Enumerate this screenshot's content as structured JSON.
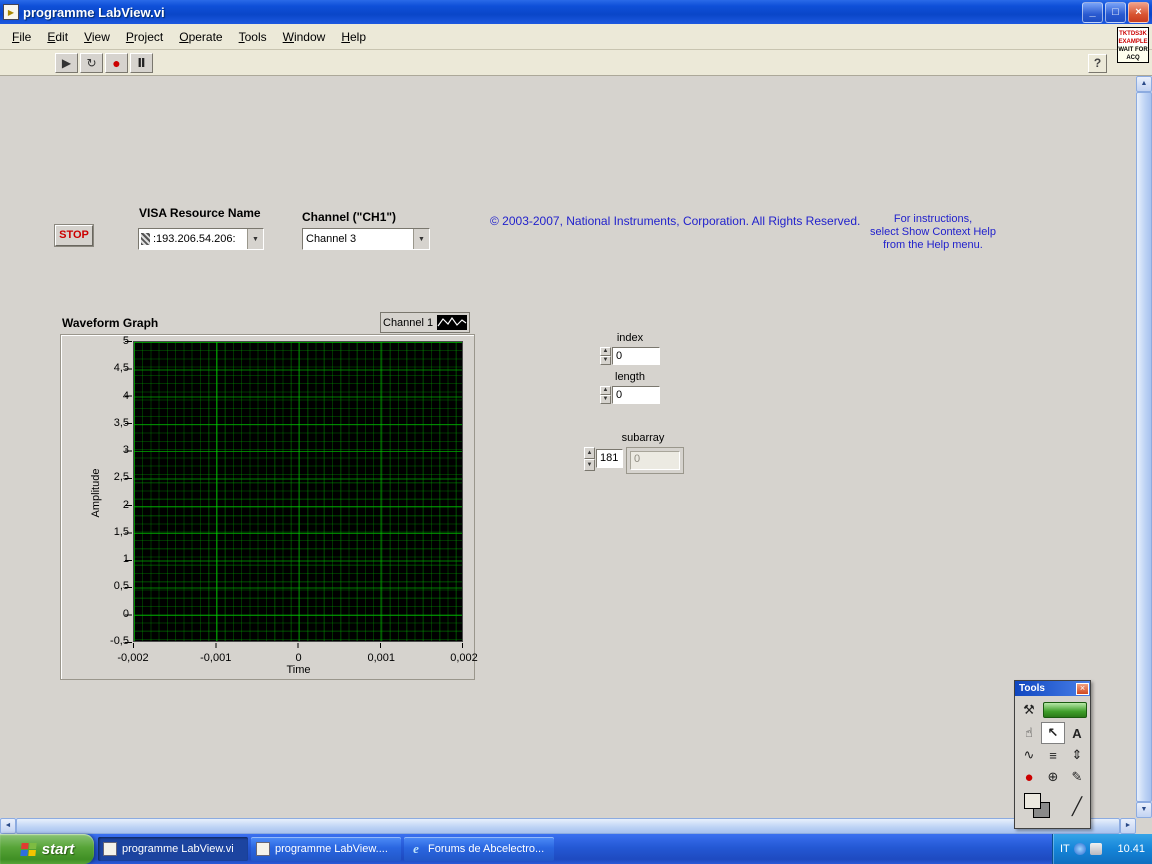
{
  "window": {
    "title": "programme LabView.vi",
    "controls": {
      "minimize": "_",
      "maximize": "□",
      "close": "×"
    }
  },
  "menu_items": [
    "File",
    "Edit",
    "View",
    "Project",
    "Operate",
    "Tools",
    "Window",
    "Help"
  ],
  "vi_icon": {
    "top_lines": [
      "TKTDS3K",
      "EXAMPLE"
    ],
    "bottom_lines": [
      "WAIT FOR",
      "ACQ"
    ]
  },
  "toolbar": {
    "run": "▶",
    "run_continuous": "↻",
    "abort": "●",
    "pause": "Ⅱ",
    "help": "?"
  },
  "icons": {
    "up": "▲",
    "down": "▼",
    "left": "◄",
    "right": "►"
  },
  "panel": {
    "stop_label": "STOP",
    "visa": {
      "label": "VISA Resource Name",
      "value": ":193.206.54.206:"
    },
    "channel": {
      "label": "Channel (\"CH1\")",
      "value": "Channel 3"
    },
    "copyright": "© 2003-2007, National Instruments, Corporation.  All Rights Reserved.",
    "instructions": [
      "For instructions,",
      "select Show Context Help",
      "from the Help menu."
    ],
    "graph": {
      "title": "Waveform Graph",
      "legend": "Channel 1",
      "ylabel": "Amplitude",
      "xlabel": "Time",
      "y_ticks": [
        "5",
        "4,5",
        "4",
        "3,5",
        "3",
        "2,5",
        "2",
        "1,5",
        "1",
        "0,5",
        "0",
        "-0,5"
      ],
      "x_ticks": [
        "-0,002",
        "-0,001",
        "0",
        "0,001",
        "0,002"
      ],
      "y_range": [
        -0.5,
        5
      ],
      "x_range": [
        -0.002,
        0.002
      ],
      "series": []
    },
    "index": {
      "label": "index",
      "value": "0"
    },
    "length": {
      "label": "length",
      "value": "0"
    },
    "subarray": {
      "label": "subarray",
      "index": "181",
      "value": "0"
    }
  },
  "tools_palette": {
    "title": "Tools",
    "close": "×",
    "tools": [
      {
        "name": "auto-tool-icon",
        "glyph": "⚒"
      },
      {
        "name": "auto-select-led",
        "glyph": ""
      },
      {
        "name": "operate-value-icon",
        "glyph": "☝"
      },
      {
        "name": "position-select-icon",
        "glyph": "↖"
      },
      {
        "name": "edit-text-icon",
        "glyph": "A"
      },
      {
        "name": "connect-wire-icon",
        "glyph": "∿"
      },
      {
        "name": "shortcut-menu-icon",
        "glyph": "≡"
      },
      {
        "name": "scroll-tool-icon",
        "glyph": "⇕"
      },
      {
        "name": "breakpoint-icon",
        "glyph": "●"
      },
      {
        "name": "probe-icon",
        "glyph": "⊕"
      },
      {
        "name": "color-copy-icon",
        "glyph": "✎"
      },
      {
        "name": "set-color-icon",
        "glyph": ""
      },
      {
        "name": "paintbrush-icon",
        "glyph": "╱"
      }
    ]
  },
  "taskbar": {
    "start": "start",
    "tasks": [
      {
        "label": "programme LabView.vi",
        "icon": "labview",
        "glyph": "",
        "active": true
      },
      {
        "label": "programme LabView....",
        "icon": "labview",
        "glyph": "",
        "active": false
      },
      {
        "label": "Forums de Abcelectro...",
        "icon": "ie",
        "glyph": "e",
        "active": false
      }
    ],
    "tray": {
      "language": "IT",
      "time": "10.41"
    }
  },
  "colors": {
    "titlebar_blue": "#0f50d8",
    "taskbar_blue": "#2458d4",
    "panel_gray": "#d6d3ce",
    "graph_grid_green": "#00b400",
    "link_text_blue": "#2222cc",
    "stop_red": "#cc0000"
  }
}
